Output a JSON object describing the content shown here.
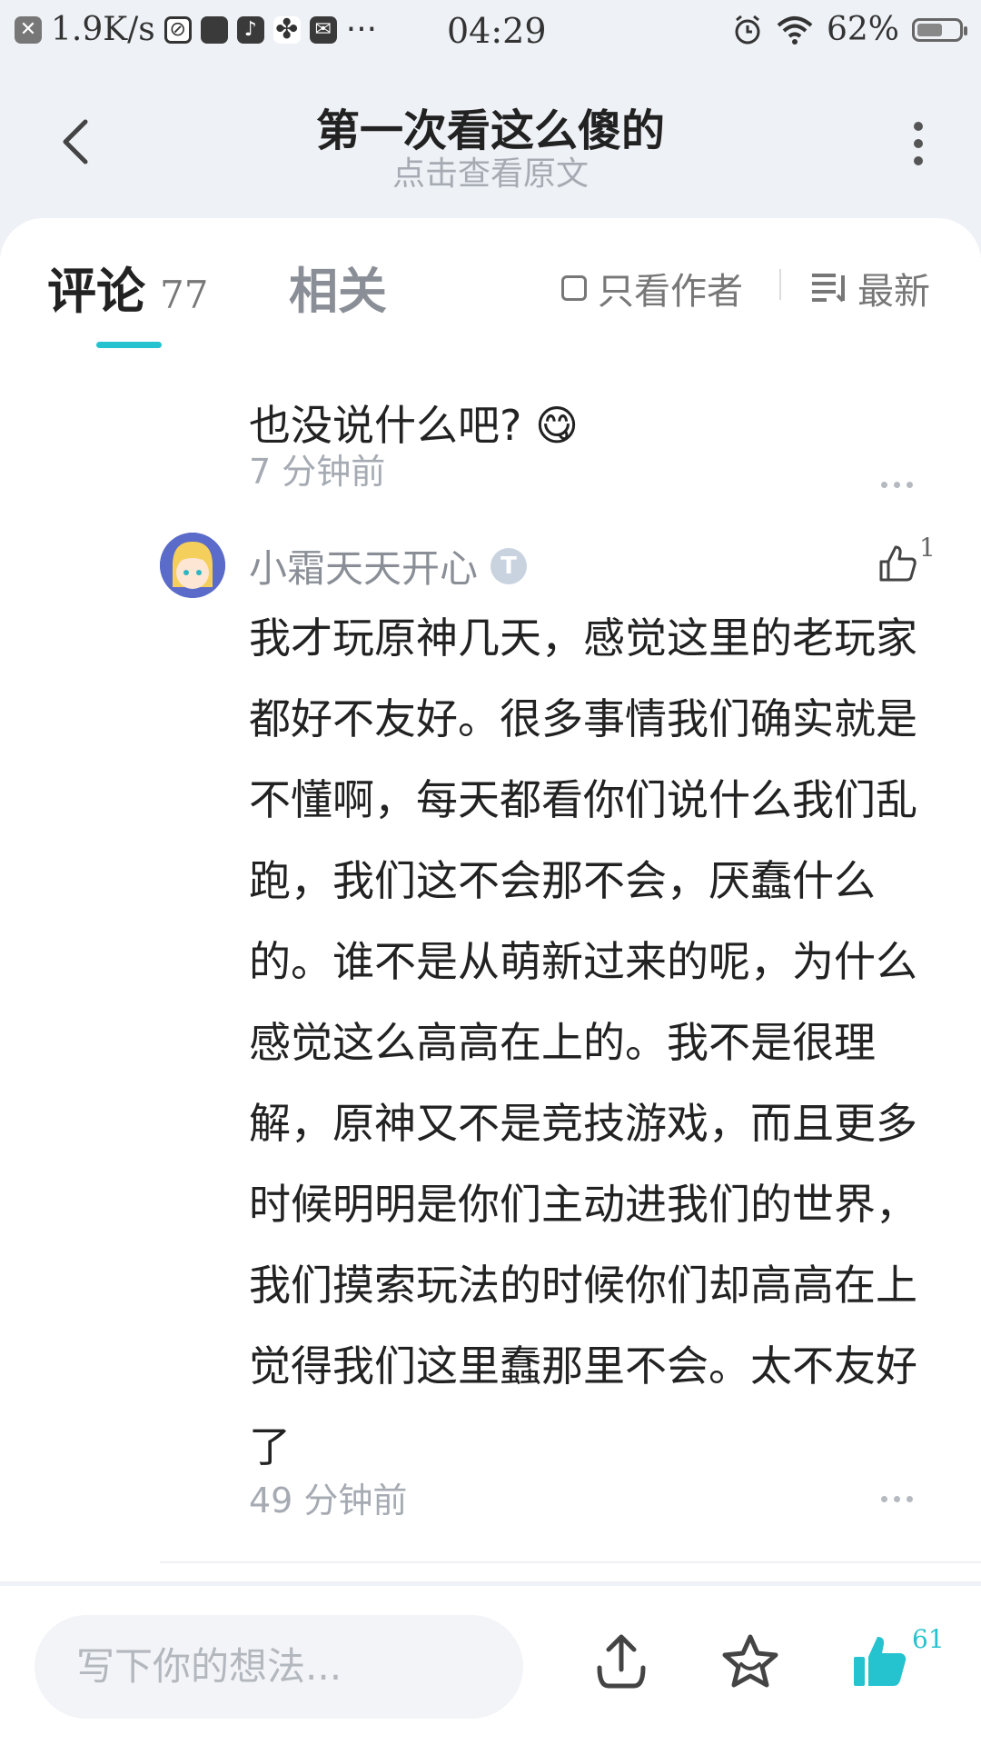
{
  "status_bar": {
    "net_speed": "1.9K/s",
    "time": "04:29",
    "battery": "62%",
    "battery_level": 0.62,
    "icons": [
      "close-box-icon",
      "no-photo-icon",
      "app-icon",
      "tiktok-icon",
      "pinwheel-icon",
      "mail-icon",
      "more-dots-icon",
      "alarm-icon",
      "wifi-icon",
      "battery-icon"
    ]
  },
  "nav": {
    "title": "第一次看这么傻的",
    "subtitle": "点击查看原文"
  },
  "tabs": {
    "comments_label": "评论",
    "comments_count": "77",
    "related_label": "相关",
    "author_only_label": "只看作者",
    "sort_label": "最新"
  },
  "previous_comment": {
    "body": "也没说什么吧? 😋",
    "time": "7 分钟前"
  },
  "comment": {
    "username": "小霜天天开心",
    "badge": "T",
    "like_count": "1",
    "body": "我才玩原神几天，感觉这里的老玩家都好不友好。很多事情我们确实就是不懂啊，每天都看你们说什么我们乱跑，我们这不会那不会，厌蠢什么的。谁不是从萌新过来的呢，为什么感觉这么高高在上的。我不是很理解，原神又不是竞技游戏，而且更多时候明明是你们主动进我们的世界，我们摸索玩法的时候你们却高高在上觉得我们这里蠢那里不会。太不友好了",
    "time": "49 分钟前"
  },
  "bottom": {
    "input_placeholder": "写下你的想法...",
    "like_count": "61"
  },
  "colors": {
    "accent": "#25c3cf",
    "muted": "#a6abb3",
    "background": "#eef1f5"
  }
}
